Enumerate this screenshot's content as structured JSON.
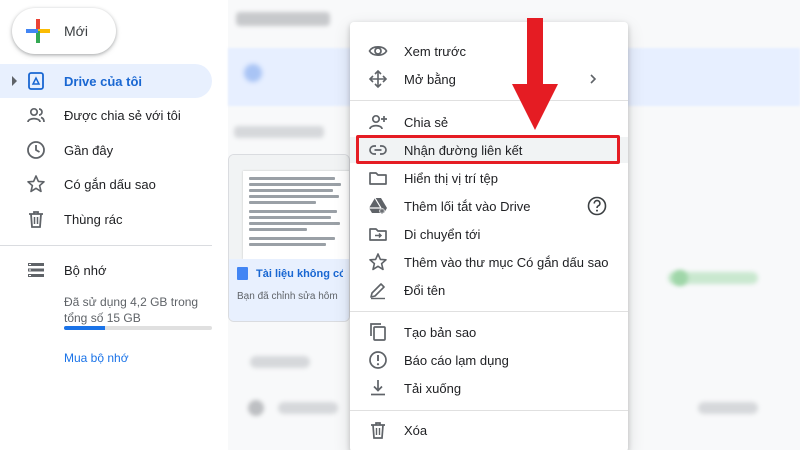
{
  "sidebar": {
    "new_label": "Mới",
    "items": [
      {
        "label": "Drive của tôi",
        "icon": "my-drive-icon"
      },
      {
        "label": "Được chia sẻ với tôi",
        "icon": "shared-icon"
      },
      {
        "label": "Gần đây",
        "icon": "clock-icon"
      },
      {
        "label": "Có gắn dấu sao",
        "icon": "star-icon"
      },
      {
        "label": "Thùng rác",
        "icon": "trash-icon"
      },
      {
        "label": "Bộ nhớ",
        "icon": "storage-icon"
      }
    ],
    "storage": {
      "usage_text": "Đã sử dụng 4,2 GB trong tổng số 15 GB",
      "used_fraction": 0.28,
      "buy_label": "Mua bộ nhớ"
    }
  },
  "file_card": {
    "name": "Tài liệu không có",
    "subtitle": "Bạn đã chỉnh sửa hôm"
  },
  "context_menu": {
    "items": [
      {
        "label": "Xem trước",
        "icon": "eye-icon"
      },
      {
        "label": "Mở bằng",
        "icon": "move-arrows-icon"
      },
      {
        "label": "Chia sẻ",
        "icon": "add-person-icon"
      },
      {
        "label": "Nhận đường liên kết",
        "icon": "link-icon"
      },
      {
        "label": "Hiển thị vị trí tệp",
        "icon": "folder-icon"
      },
      {
        "label": "Thêm lối tắt vào Drive",
        "icon": "drive-shortcut-icon"
      },
      {
        "label": "Di chuyển tới",
        "icon": "move-to-folder-icon"
      },
      {
        "label": "Thêm vào thư mục Có gắn dấu sao",
        "icon": "star-icon"
      },
      {
        "label": "Đổi tên",
        "icon": "pencil-icon"
      },
      {
        "label": "Tạo bản sao",
        "icon": "copy-icon"
      },
      {
        "label": "Báo cáo lạm dụng",
        "icon": "report-icon"
      },
      {
        "label": "Tải xuống",
        "icon": "download-icon"
      },
      {
        "label": "Xóa",
        "icon": "trash-icon"
      }
    ],
    "highlighted_item": "Nhận đường liên kết"
  },
  "colors": {
    "accent": "#1a73e8",
    "active_bg": "#e8f0fe",
    "highlight_box": "#e51c23"
  }
}
